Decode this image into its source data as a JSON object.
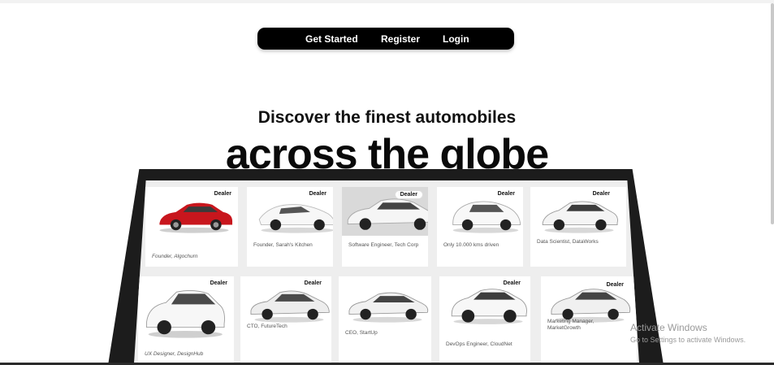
{
  "nav": {
    "items": [
      "Get Started",
      "Register",
      "Login"
    ]
  },
  "hero": {
    "subtitle": "Discover the finest automobiles",
    "title": "across the globe"
  },
  "dealer_badge": "Dealer",
  "cards": [
    {
      "caption": "Founder, Algochurn",
      "badge": true,
      "color": "#c8161d"
    },
    {
      "caption": "Founder, Sarah's Kitchen",
      "badge": true,
      "color": "#f4f4f4"
    },
    {
      "caption": "Software Engineer, Tech Corp",
      "badge": true,
      "color": "#e8e8e8"
    },
    {
      "caption": "Only 10.000 kms driven",
      "badge": true,
      "color": "#f2f2f2"
    },
    {
      "caption": "Data Scientist, DataWorks",
      "badge": true,
      "color": "#eeeeee"
    },
    {
      "caption": "UX Designer, DesignHub",
      "badge": true,
      "color": "#f0f0f0"
    },
    {
      "caption": "CTO, FutureTech",
      "badge": true,
      "color": "#e6e6e6"
    },
    {
      "caption": "CEO, StartUp",
      "badge": false,
      "color": "#ededed"
    },
    {
      "caption": "DevOps Engineer, CloudNet",
      "badge": true,
      "color": "#f3f3f3"
    },
    {
      "caption": "Marketing Manager, MarketGrowth",
      "badge": true,
      "color": "#ececec"
    }
  ],
  "watermark": {
    "line1": "Activate Windows",
    "line2": "Go to Settings to activate Windows."
  }
}
